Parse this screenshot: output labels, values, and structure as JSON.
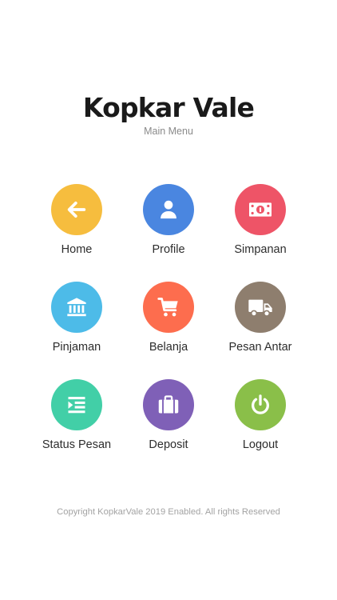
{
  "header": {
    "app_title": "Kopkar Vale",
    "subtitle": "Main Menu"
  },
  "menu": [
    {
      "label": "Home",
      "icon": "arrow-left-icon",
      "color": "#F6BD3E"
    },
    {
      "label": "Profile",
      "icon": "user-icon",
      "color": "#4A86E0"
    },
    {
      "label": "Simpanan",
      "icon": "money-bill-icon",
      "color": "#EE5467"
    },
    {
      "label": "Pinjaman",
      "icon": "bank-icon",
      "color": "#4DBBE8"
    },
    {
      "label": "Belanja",
      "icon": "shopping-cart-icon",
      "color": "#FD6D4E"
    },
    {
      "label": "Pesan Antar",
      "icon": "truck-icon",
      "color": "#8E7E6E"
    },
    {
      "label": "Status Pesan",
      "icon": "list-indent-icon",
      "color": "#42CFA7"
    },
    {
      "label": "Deposit",
      "icon": "suitcase-icon",
      "color": "#7F60B7"
    },
    {
      "label": "Logout",
      "icon": "power-icon",
      "color": "#8ABF49"
    }
  ],
  "footer": {
    "copyright": "Copyright KopkarVale 2019 Enabled. All rights Reserved"
  }
}
